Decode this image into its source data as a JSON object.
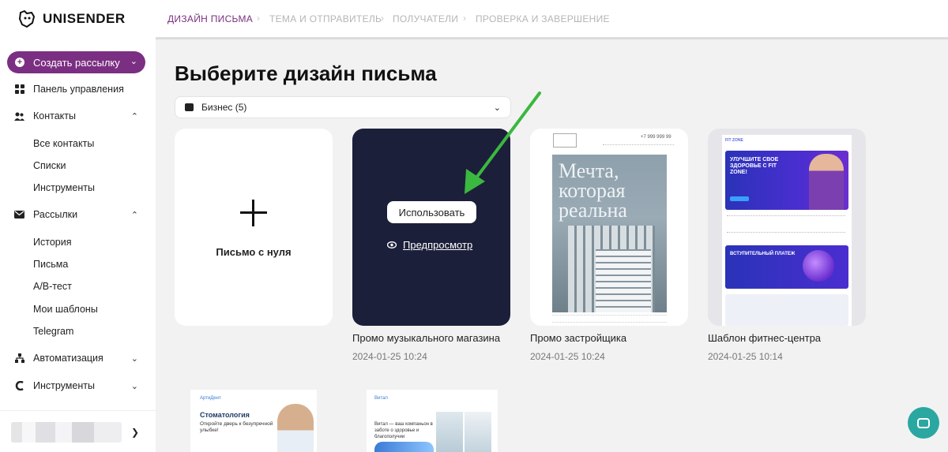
{
  "brand": {
    "name": "UNISENDER",
    "accent": "#7b2f82",
    "dark_card": "#1c1f3a",
    "chat_color": "#2aa7a0"
  },
  "sidebar": {
    "create_button": "Создать рассылку",
    "items": [
      {
        "label": "Панель управления",
        "icon": "dashboard-icon"
      },
      {
        "label": "Контакты",
        "icon": "contacts-icon",
        "sub": [
          "Все контакты",
          "Списки",
          "Инструменты"
        ]
      },
      {
        "label": "Рассылки",
        "icon": "mail-icon",
        "sub": [
          "История",
          "Письма",
          "A/B-тест",
          "Мои шаблоны",
          "Telegram"
        ]
      },
      {
        "label": "Автоматизация",
        "icon": "automation-icon"
      },
      {
        "label": "Инструменты",
        "icon": "tools-icon"
      }
    ]
  },
  "steps": [
    "ДИЗАЙН ПИСЬМА",
    "ТЕМА И ОТПРАВИТЕЛЬ",
    "ПОЛУЧАТЕЛИ",
    "ПРОВЕРКА И ЗАВЕРШЕНИЕ"
  ],
  "main": {
    "title": "Выберите дизайн письма",
    "filter": "Бизнес (5)",
    "blank_card": "Письмо с нуля",
    "use_button": "Использовать",
    "preview_link": "Предпросмотр",
    "templates": [
      {
        "title": "Промо музыкального магазина",
        "date": "2024-01-25 10:24"
      },
      {
        "title": "Промо застройщика",
        "date": "2024-01-25 10:24",
        "hero_text": "Мечта, которая реальна",
        "phone": "+7 999 999 99"
      },
      {
        "title": "Шаблон фитнес-центра",
        "date": "2024-01-25 10:14",
        "brand": "FIT ZONE",
        "banner": "УЛУЧШИТЕ СВОЕ ЗДОРОВЬЕ С FIT ZONE!",
        "banner2": "ВСТУПИТЕЛЬНЫЙ ПЛАТЕЖ"
      }
    ],
    "second_row": [
      {
        "logo": "АртиДент",
        "heading": "Стоматология",
        "text": "Откройте дверь к безупречной улыбке!"
      },
      {
        "logo": "Витал",
        "text": "Витал — ваш компаньон в заботе о здоровье и благополучии"
      }
    ]
  }
}
